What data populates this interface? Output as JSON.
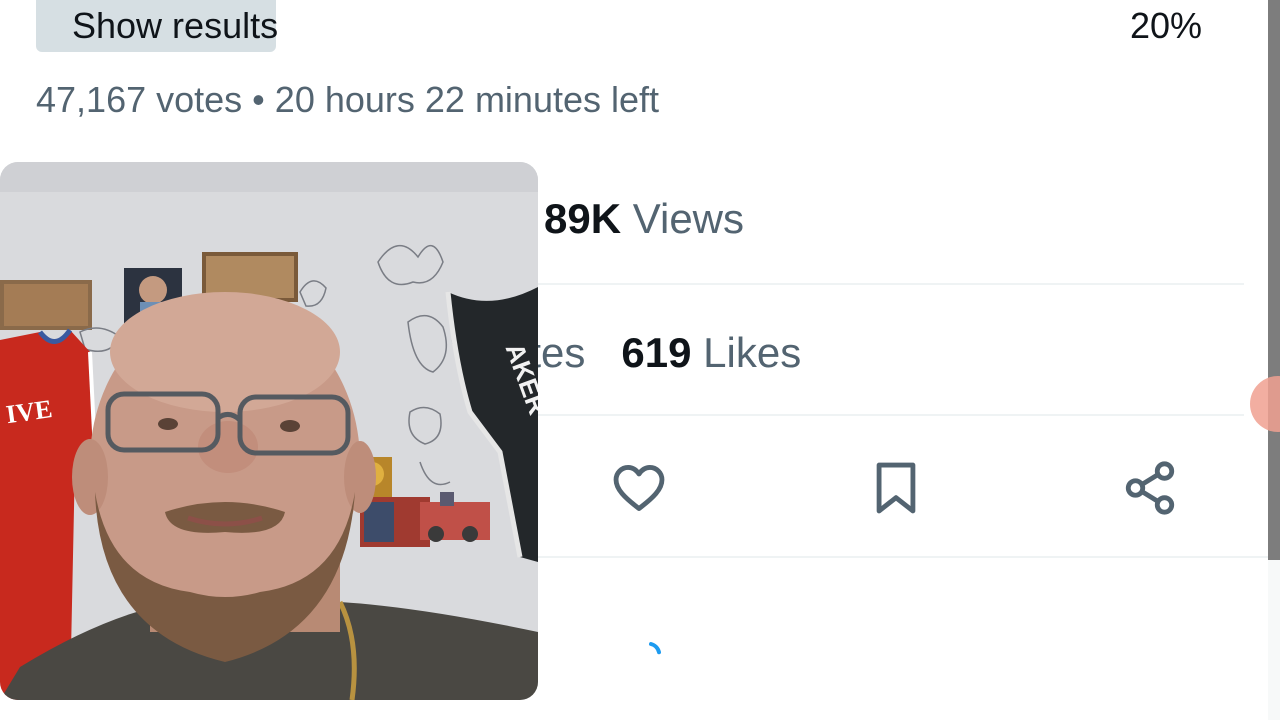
{
  "poll": {
    "show_results_label": "Show results",
    "percent": "20%",
    "votes": "47,167 votes",
    "separator": "•",
    "time_left": "20 hours 22 minutes left"
  },
  "stats": {
    "views_count": "89K",
    "views_label": "Views",
    "quotes_label": "Quotes",
    "likes_count": "619",
    "likes_label": "Likes"
  },
  "actions": {
    "like_icon": "heart-icon",
    "bookmark_icon": "bookmark-icon",
    "share_icon": "share-icon"
  },
  "loading": {
    "icon": "loading-spinner-icon"
  },
  "webcam": {
    "jersey_lettering": "IVE",
    "jersey2_lettering": "AKER"
  },
  "colors": {
    "text_primary": "#0f1419",
    "text_secondary": "#536471",
    "poll_bar": "#cfd9de",
    "accent": "#1d9bf0",
    "divider": "#eff3f4"
  }
}
